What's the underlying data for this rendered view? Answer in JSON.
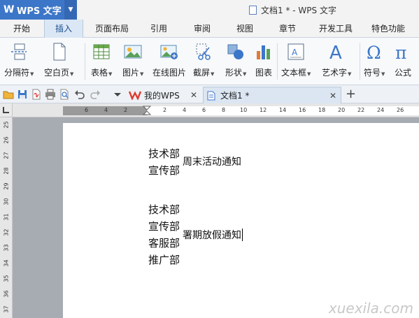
{
  "title_bar": {
    "app_name": "WPS 文字",
    "doc_title": "文档1 * - WPS 文字"
  },
  "menu_tabs": [
    "开始",
    "插入",
    "页面布局",
    "引用",
    "审阅",
    "视图",
    "章节",
    "开发工具",
    "特色功能"
  ],
  "active_tab": "插入",
  "ribbon": {
    "page_break": "分隔符",
    "blank_page": "空白页",
    "table": "表格",
    "picture": "图片",
    "online_picture": "在线图片",
    "screenshot": "截屏",
    "shape": "形状",
    "chart": "图表",
    "textbox": "文本框",
    "wordart": "艺术字",
    "symbol": "符号",
    "formula": "公式"
  },
  "doc_tabs": {
    "my_wps": "我的WPS",
    "doc1": "文档1 *"
  },
  "ruler": {
    "h_labels": [
      "6",
      "4",
      "2",
      "2",
      "4",
      "6",
      "8",
      "10",
      "12",
      "14",
      "16",
      "18",
      "20",
      "22",
      "24",
      "26"
    ],
    "v_labels": [
      "25",
      "26",
      "27",
      "28",
      "29",
      "30",
      "31",
      "32",
      "33",
      "34",
      "35",
      "36",
      "37"
    ]
  },
  "document": {
    "group1": [
      "技术部",
      "宣传部"
    ],
    "group1_suffix": "周末活动通知",
    "group2": [
      "技术部",
      "宣传部",
      "客服部",
      "推广部"
    ],
    "group2_suffix": "署期放假通知"
  },
  "watermark": "xuexila.com",
  "colors": {
    "app_blue": "#3c76c8",
    "active_tab_bg": "#dbe7f4",
    "workspace_gray": "#a7acb3",
    "wps_red": "#e03b2e"
  }
}
